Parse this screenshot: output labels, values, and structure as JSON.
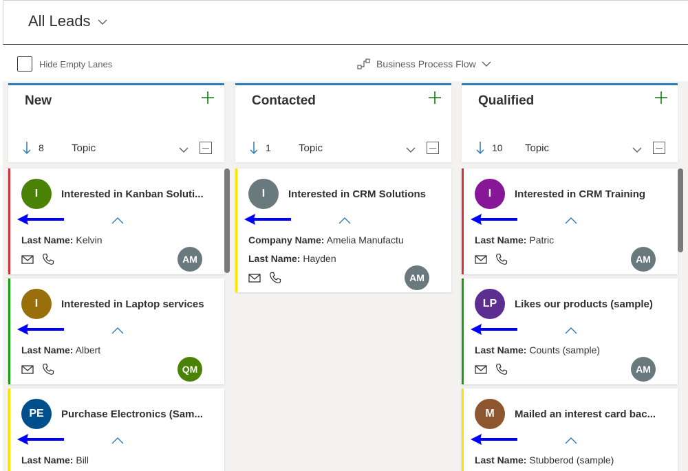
{
  "header": {
    "view_title": "All Leads"
  },
  "toolbar": {
    "hide_empty_lanes": "Hide Empty Lanes",
    "bpf_label": "Business Process Flow"
  },
  "lanes": [
    {
      "title": "New",
      "count": "8",
      "sort_field": "Topic",
      "cards": [
        {
          "initials": "I",
          "avatar_color": "#498205",
          "stripe": "#d13438",
          "title": "Interested in Kanban Soluti...",
          "fields": [
            {
              "label": "Last Name:",
              "value": "Kelvin"
            }
          ],
          "owner": "AM",
          "owner_color": "#69797e"
        },
        {
          "initials": "I",
          "avatar_color": "#986f0b",
          "stripe": "#13a10e",
          "title": "Interested in Laptop services",
          "fields": [
            {
              "label": "Last Name:",
              "value": "Albert"
            }
          ],
          "owner": "QM",
          "owner_color": "#498205"
        },
        {
          "initials": "PE",
          "avatar_color": "#004e8c",
          "stripe": "#fde300",
          "title": "Purchase Electronics (Sam...",
          "fields": [
            {
              "label": "Last Name:",
              "value": "Bill"
            }
          ],
          "owner": "",
          "owner_color": "#69797e"
        }
      ]
    },
    {
      "title": "Contacted",
      "count": "1",
      "sort_field": "Topic",
      "cards": [
        {
          "initials": "I",
          "avatar_color": "#69797e",
          "stripe": "#fde300",
          "title": "Interested in CRM Solutions",
          "fields": [
            {
              "label": "Company Name:",
              "value": "Amelia Manufactu"
            },
            {
              "label": "Last Name:",
              "value": "Hayden"
            }
          ],
          "owner": "AM",
          "owner_color": "#69797e"
        }
      ]
    },
    {
      "title": "Qualified",
      "count": "10",
      "sort_field": "Topic",
      "cards": [
        {
          "initials": "I",
          "avatar_color": "#881798",
          "stripe": "#d13438",
          "title": "Interested in CRM Training",
          "fields": [
            {
              "label": "Last Name:",
              "value": "Patric"
            }
          ],
          "owner": "AM",
          "owner_color": "#69797e"
        },
        {
          "initials": "LP",
          "avatar_color": "#5c2e91",
          "stripe": "#13a10e",
          "title": "Likes our products (sample)",
          "fields": [
            {
              "label": "Last Name:",
              "value": "Counts (sample)"
            }
          ],
          "owner": "AM",
          "owner_color": "#69797e"
        },
        {
          "initials": "M",
          "avatar_color": "#8e562e",
          "stripe": "#fde300",
          "title": "Mailed an interest card bac...",
          "fields": [
            {
              "label": "Last Name:",
              "value": "Stubberod (sample)"
            }
          ],
          "owner": "",
          "owner_color": "#69797e"
        }
      ]
    }
  ],
  "icons": {
    "add": "plus-icon",
    "sort": "sort-down-arrow-icon",
    "mail": "mail-icon",
    "phone": "phone-icon",
    "expand": "chevron-up-icon",
    "annotation": "blue-arrow-left-icon"
  },
  "colors": {
    "accent": "#2d7bb6",
    "add_green": "#107c10",
    "annotation_blue": "#0000ff"
  }
}
